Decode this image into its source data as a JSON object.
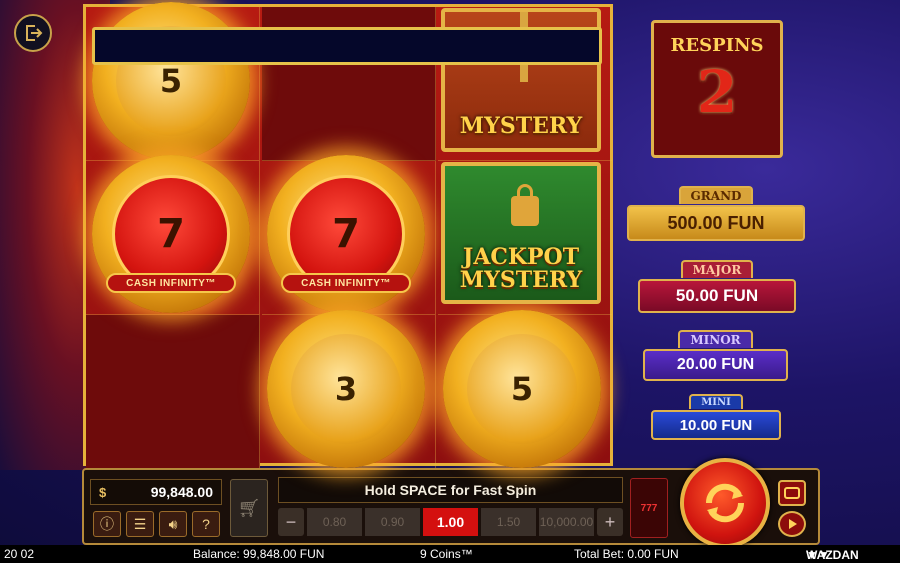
{
  "respins": {
    "label": "RESPINS",
    "count": "2"
  },
  "jackpots": {
    "grand": {
      "label": "GRAND",
      "amount": "500.00 FUN"
    },
    "major": {
      "label": "MAJOR",
      "amount": "50.00 FUN"
    },
    "minor": {
      "label": "MINOR",
      "amount": "20.00 FUN"
    },
    "mini": {
      "label": "MINI",
      "amount": "10.00 FUN"
    }
  },
  "reels": {
    "coin_top_left": "5",
    "coin_mid_left": "7",
    "coin_mid_center": "7",
    "coin_bottom_center": "3",
    "coin_bottom_right": "5",
    "cash_infinity_label": "CASH INFINITY™",
    "mystery_label": "MYSTERY",
    "jackpot_mystery_label_1": "JACKPOT",
    "jackpot_mystery_label_2": "MYSTERY"
  },
  "panel": {
    "balance": "99,848.00",
    "hold_text": "Hold SPACE for Fast Spin",
    "bets": [
      "0.80",
      "0.90",
      "1.00",
      "1.50",
      "10,000.00"
    ],
    "selected_bet": "1.00",
    "card_label": "777"
  },
  "status": {
    "time": "20 02",
    "balance": "Balance: 99,848.00 FUN",
    "game": "9 Coins™",
    "total_bet": "Total Bet: 0.00 FUN",
    "brand": "WAZDAN"
  },
  "colors": {
    "gold": "#e0b24c",
    "red": "#d4100f",
    "navy": "#05072a"
  }
}
